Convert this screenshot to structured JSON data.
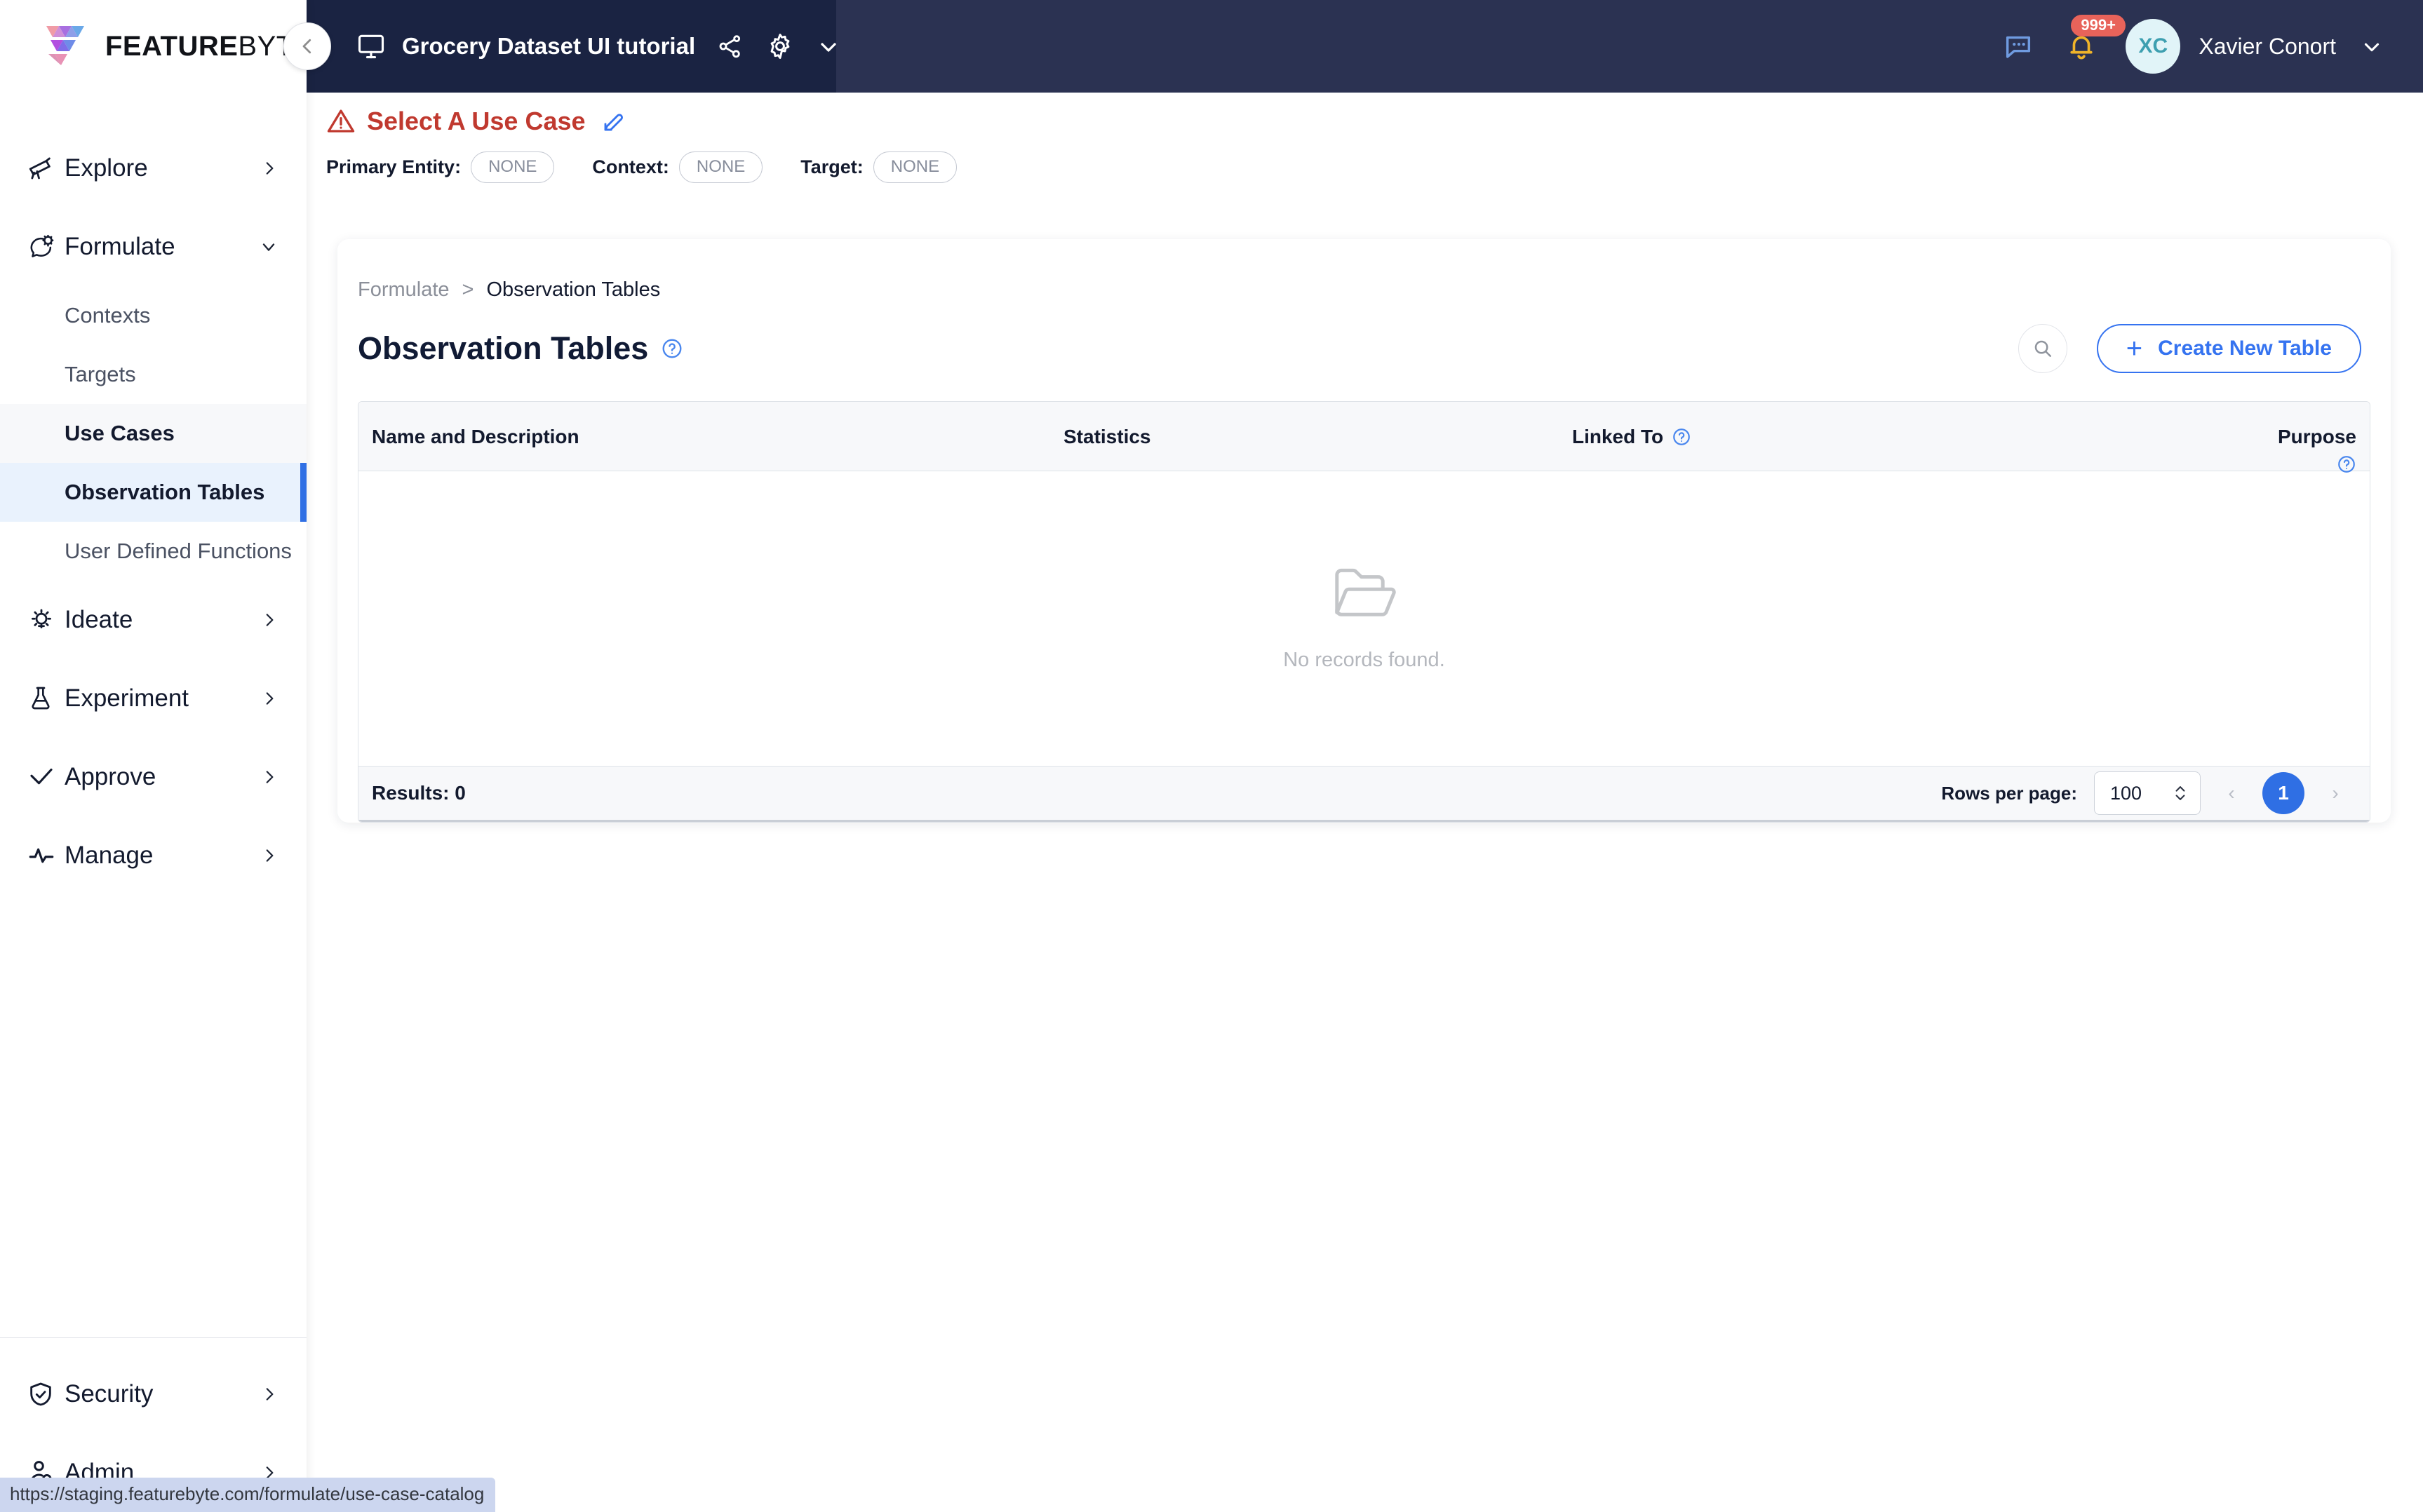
{
  "brand": {
    "logo_text_bold": "FEATURE",
    "logo_text_light": "BYTE",
    "accent_blue": "#2f6fe4",
    "header_dark": "#1a2342",
    "header_dark2": "#2b3252",
    "warning_red": "#c0392f"
  },
  "header": {
    "catalog_name": "Grocery Dataset UI tutorial",
    "monitor_icon": "monitor-icon",
    "share_icon": "share-icon",
    "gear_icon": "gear-icon",
    "chevron_down_icon": "chevron-down-icon",
    "collapse_icon": "chevron-left-icon",
    "chat_icon": "chat-bubble-icon",
    "bell_icon": "bell-icon",
    "notification_badge": "999+",
    "avatar_initials": "XC",
    "user_name": "Xavier Conort",
    "user_chevron_icon": "chevron-down-icon"
  },
  "use_case_bar": {
    "warning_icon": "warning-triangle-icon",
    "title": "Select A Use Case",
    "edit_icon": "pencil-edit-icon",
    "fields": [
      {
        "label": "Primary Entity:",
        "value": "NONE"
      },
      {
        "label": "Context:",
        "value": "NONE"
      },
      {
        "label": "Target:",
        "value": "NONE"
      }
    ]
  },
  "sidebar": {
    "items": [
      {
        "label": "Explore",
        "icon": "telescope-icon",
        "chevron": "chevron-right-icon"
      },
      {
        "label": "Formulate",
        "icon": "brain-gear-icon",
        "chevron": "chevron-down-icon"
      }
    ],
    "formulate_children": [
      {
        "label": "Contexts",
        "state": "default"
      },
      {
        "label": "Targets",
        "state": "default"
      },
      {
        "label": "Use Cases",
        "state": "hovered"
      },
      {
        "label": "Observation Tables",
        "state": "active"
      },
      {
        "label": "User Defined Functions",
        "state": "default"
      }
    ],
    "items_after": [
      {
        "label": "Ideate",
        "icon": "lightbulb-icon",
        "chevron": "chevron-right-icon"
      },
      {
        "label": "Experiment",
        "icon": "flask-icon",
        "chevron": "chevron-right-icon"
      },
      {
        "label": "Approve",
        "icon": "check-icon",
        "chevron": "chevron-right-icon"
      },
      {
        "label": "Manage",
        "icon": "pulse-icon",
        "chevron": "chevron-right-icon"
      }
    ],
    "bottom_items": [
      {
        "label": "Security",
        "icon": "shield-check-icon",
        "chevron": "chevron-right-icon"
      },
      {
        "label": "Admin",
        "icon": "user-search-icon",
        "chevron": "chevron-right-icon"
      }
    ]
  },
  "main": {
    "breadcrumb": {
      "parent": "Formulate",
      "separator": ">",
      "current": "Observation Tables"
    },
    "page_title": "Observation Tables",
    "page_title_help_icon": "help-circle-icon",
    "search_icon": "search-icon",
    "create_button": {
      "plus": "+",
      "label": "Create New Table"
    },
    "table": {
      "columns": [
        {
          "key": "name",
          "label": "Name and Description",
          "help": false
        },
        {
          "key": "statistics",
          "label": "Statistics",
          "help": false
        },
        {
          "key": "linked_to",
          "label": "Linked To",
          "help": true
        },
        {
          "key": "purpose",
          "label": "Purpose",
          "help": true
        }
      ],
      "rows": [],
      "empty_icon": "open-folder-icon",
      "empty_message": "No records found."
    },
    "footer": {
      "results_label": "Results: 0",
      "rows_per_page_label": "Rows per page:",
      "rows_per_page_value": "100",
      "stepper_icon": "chevron-updown-icon",
      "prev_icon": "‹",
      "current_page": "1",
      "next_icon": "›"
    }
  },
  "status_bar": {
    "url": "https://staging.featurebyte.com/formulate/use-case-catalog"
  }
}
